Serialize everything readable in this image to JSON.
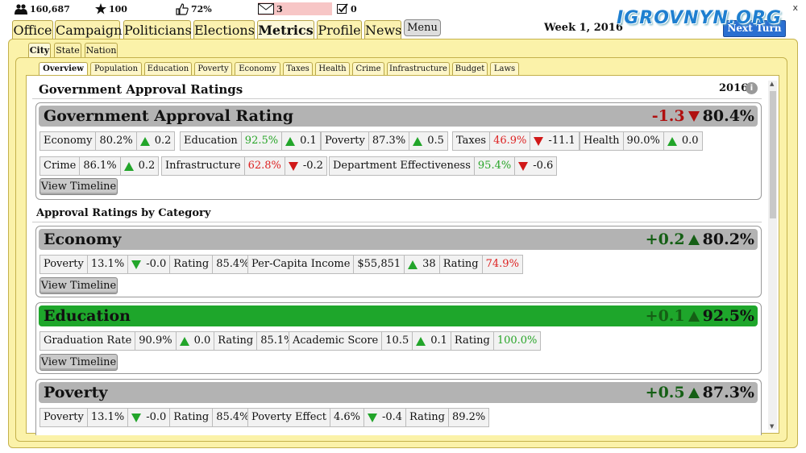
{
  "stats": {
    "population": "160,687",
    "stars": "100",
    "approval": "72%",
    "messages": "3",
    "tasks": "0"
  },
  "watermark": "IGROVNYN.ORG",
  "next_turn_label": "Next Turn",
  "close_label": "x",
  "week": "Week 1, 2016",
  "main_tabs": [
    "Office",
    "Campaign",
    "Politicians",
    "Elections",
    "Metrics",
    "Profile",
    "News"
  ],
  "menu_label": "Menu",
  "sub_tabs": [
    "City",
    "State",
    "Nation"
  ],
  "metric_tabs": [
    "Overview",
    "Population",
    "Education",
    "Poverty",
    "Economy",
    "Taxes",
    "Health",
    "Crime",
    "Infrastructure",
    "Budget",
    "Laws"
  ],
  "section_title": "Government Approval Ratings",
  "year": "2016",
  "info_icon": "i",
  "gov": {
    "title": "Government Approval Rating",
    "change": "-1.3",
    "value": "80.4%",
    "row1": [
      {
        "label": "Economy",
        "value": "80.2%",
        "delta": "0.2"
      },
      {
        "label": "Education",
        "value": "92.5%",
        "delta": "0.1"
      },
      {
        "label": "Poverty",
        "value": "87.3%",
        "delta": "0.5"
      },
      {
        "label": "Taxes",
        "value": "46.9%",
        "delta": "-11.1"
      },
      {
        "label": "Health",
        "value": "90.0%",
        "delta": "0.0"
      }
    ],
    "row2": [
      {
        "label": "Crime",
        "value": "86.1%",
        "delta": "0.2"
      },
      {
        "label": "Infrastructure",
        "value": "62.8%",
        "delta": "-0.2"
      },
      {
        "label": "Department Effectiveness",
        "value": "95.4%",
        "delta": "-0.6"
      }
    ]
  },
  "view_timeline": "View Timeline",
  "category_header": "Approval Ratings by Category",
  "economy": {
    "title": "Economy",
    "change": "+0.2",
    "value": "80.2%",
    "poverty_label": "Poverty",
    "poverty_value": "13.1%",
    "poverty_delta": "-0.0",
    "rating_label": "Rating",
    "rating1": "85.4%",
    "income_label": "Per-Capita Income",
    "income_value": "$55,851",
    "income_delta": "38",
    "rating2": "74.9%"
  },
  "education": {
    "title": "Education",
    "change": "+0.1",
    "value": "92.5%",
    "grad_label": "Graduation Rate",
    "grad_value": "90.9%",
    "grad_delta": "0.0",
    "rating_label": "Rating",
    "rating1": "85.1%",
    "acad_label": "Academic Score",
    "acad_value": "10.5",
    "acad_delta": "0.1",
    "rating2": "100.0%"
  },
  "poverty": {
    "title": "Poverty",
    "change": "+0.5",
    "value": "87.3%",
    "pov_label": "Poverty",
    "pov_value": "13.1%",
    "pov_delta": "-0.0",
    "rating_label": "Rating",
    "rating1": "85.4%",
    "effect_label": "Poverty Effect",
    "effect_value": "4.6%",
    "effect_delta": "-0.4",
    "rating2": "89.2%"
  }
}
